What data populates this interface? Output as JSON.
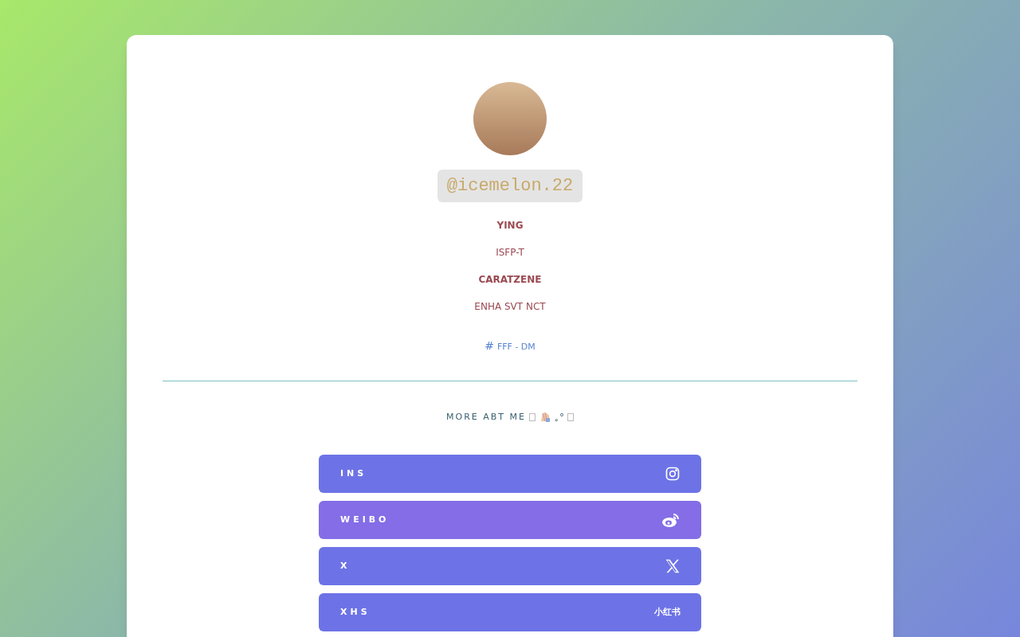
{
  "profile": {
    "handle": "@icemelon.22",
    "lines": [
      {
        "text": "YING",
        "bold": true
      },
      {
        "text": "ISFP-T",
        "bold": false
      },
      {
        "text": "CARATZENE",
        "bold": true
      },
      {
        "text": "ENHA SVT NCT",
        "bold": false
      }
    ],
    "tag": {
      "symbol": "#",
      "text": "FFF - DM"
    }
  },
  "section": {
    "title": "MORE ABT ME",
    "decoration": "｡°"
  },
  "links": [
    {
      "label": "INS",
      "kind": "instagram",
      "color": "#6d73e6"
    },
    {
      "label": "WEIBO",
      "kind": "weibo",
      "color": "#846de6"
    },
    {
      "label": "X",
      "kind": "x",
      "color": "#6d73e6"
    },
    {
      "label": "XHS",
      "kind": "text",
      "icon_text": "小红书",
      "color": "#6d73e6"
    }
  ]
}
